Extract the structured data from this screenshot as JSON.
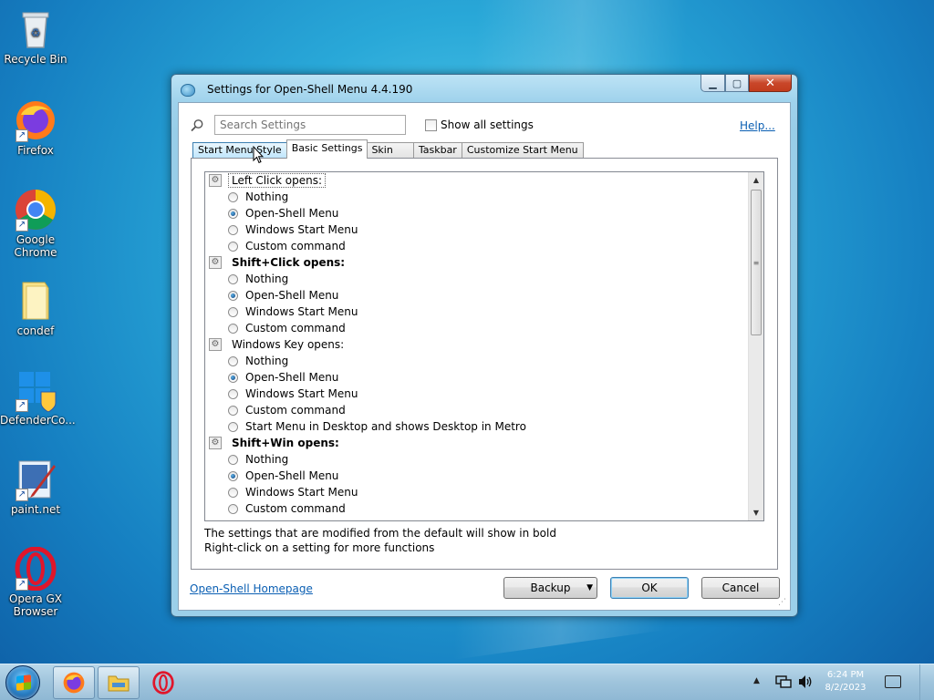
{
  "desktop": {
    "icons": [
      {
        "label": "Recycle Bin"
      },
      {
        "label": "Firefox"
      },
      {
        "label": "Google Chrome"
      },
      {
        "label": "condef"
      },
      {
        "label": "DefenderCo..."
      },
      {
        "label": "paint.net"
      },
      {
        "label": "Opera GX Browser"
      }
    ]
  },
  "dialog": {
    "title": "Settings for Open-Shell Menu 4.4.190",
    "search_placeholder": "Search Settings",
    "show_all_label": "Show all settings",
    "help_label": "Help...",
    "tabs": [
      {
        "label": "Start Menu Style"
      },
      {
        "label": "Basic Settings"
      },
      {
        "label": "Skin"
      },
      {
        "label": "Taskbar"
      },
      {
        "label": "Customize Start Menu"
      }
    ],
    "groups": [
      {
        "label": "Left Click opens:",
        "options": [
          "Nothing",
          "Open-Shell Menu",
          "Windows Start Menu",
          "Custom command"
        ]
      },
      {
        "label": "Shift+Click opens:",
        "options": [
          "Nothing",
          "Open-Shell Menu",
          "Windows Start Menu",
          "Custom command"
        ]
      },
      {
        "label": "Windows Key opens:",
        "options": [
          "Nothing",
          "Open-Shell Menu",
          "Windows Start Menu",
          "Custom command",
          "Start Menu in Desktop and shows Desktop in Metro"
        ]
      },
      {
        "label": "Shift+Win opens:",
        "options": [
          "Nothing",
          "Open-Shell Menu",
          "Windows Start Menu",
          "Custom command"
        ]
      }
    ],
    "hint_line1": "The settings that are modified from the default will show in bold",
    "hint_line2": "Right-click on a setting for more functions",
    "homepage_label": "Open-Shell Homepage",
    "backup_label": "Backup",
    "ok_label": "OK",
    "cancel_label": "Cancel"
  },
  "taskbar": {
    "time": "6:24 PM",
    "date": "8/2/2023"
  }
}
